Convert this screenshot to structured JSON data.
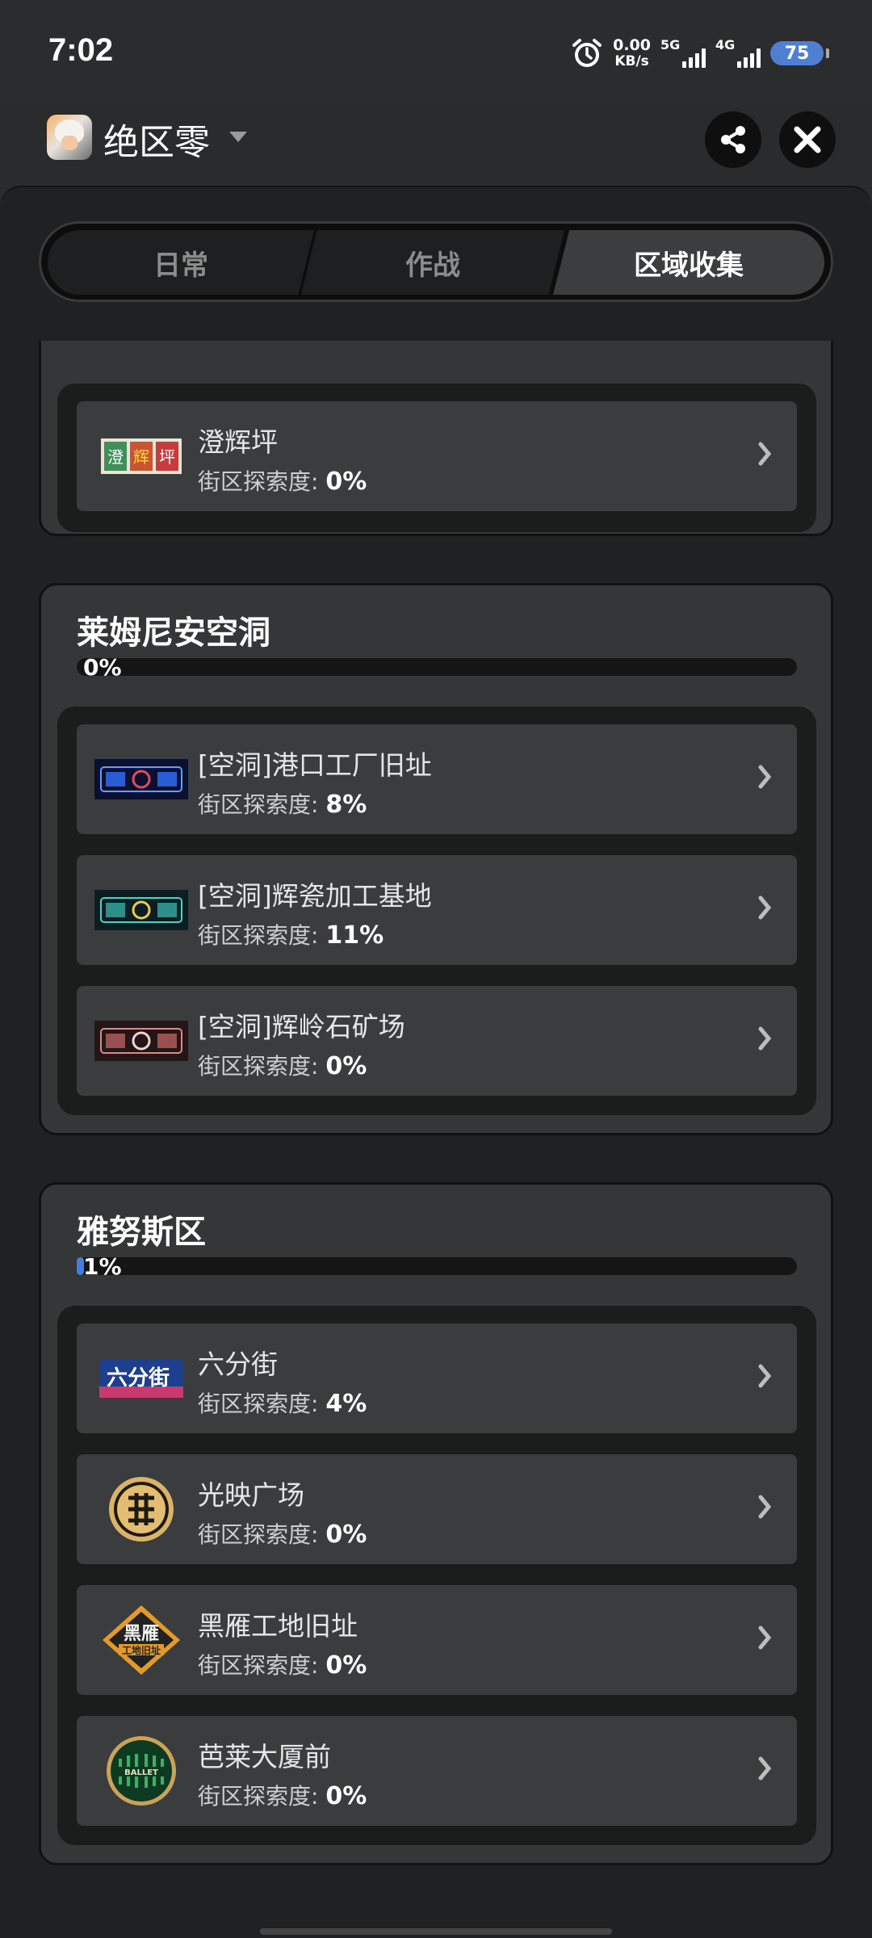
{
  "status_bar": {
    "time": "7:02",
    "net_speed_value": "0.00",
    "net_speed_unit": "KB/s",
    "sim1_type": "5G",
    "sim2_type": "4G",
    "battery": "75"
  },
  "app": {
    "title": "绝区零"
  },
  "tabs": [
    {
      "label": "日常",
      "active": false
    },
    {
      "label": "作战",
      "active": false
    },
    {
      "label": "区域收集",
      "active": true
    }
  ],
  "item_prefix": "街区探索度: ",
  "regions": [
    {
      "title": "",
      "items": [
        {
          "name": "澄辉坪",
          "progress": "0%",
          "icon": "chenghuiping-sign-icon"
        }
      ]
    },
    {
      "title": "莱姆尼安空洞",
      "progress": "0%",
      "progress_value": 0,
      "items": [
        {
          "name": "[空洞]港口工厂旧址",
          "progress": "8%",
          "icon": "port-factory-neon-icon"
        },
        {
          "name": "[空洞]辉瓷加工基地",
          "progress": "11%",
          "icon": "porcelain-base-neon-icon"
        },
        {
          "name": "[空洞]辉岭石矿场",
          "progress": "0%",
          "icon": "stone-quarry-neon-icon"
        }
      ]
    },
    {
      "title": "雅努斯区",
      "progress": "1%",
      "progress_value": 1,
      "items": [
        {
          "name": "六分街",
          "progress": "4%",
          "icon": "sixth-street-sign-icon"
        },
        {
          "name": "光映广场",
          "progress": "0%",
          "icon": "lumina-square-coin-icon"
        },
        {
          "name": "黑雁工地旧址",
          "progress": "0%",
          "icon": "blackgoose-site-badge-icon"
        },
        {
          "name": "芭莱大厦前",
          "progress": "0%",
          "icon": "ballet-twins-badge-icon"
        }
      ]
    }
  ],
  "colors": {
    "accent_blue": "#3f7fe0",
    "panel_bg": "#202122",
    "item_bg": "#3b3c3d"
  }
}
